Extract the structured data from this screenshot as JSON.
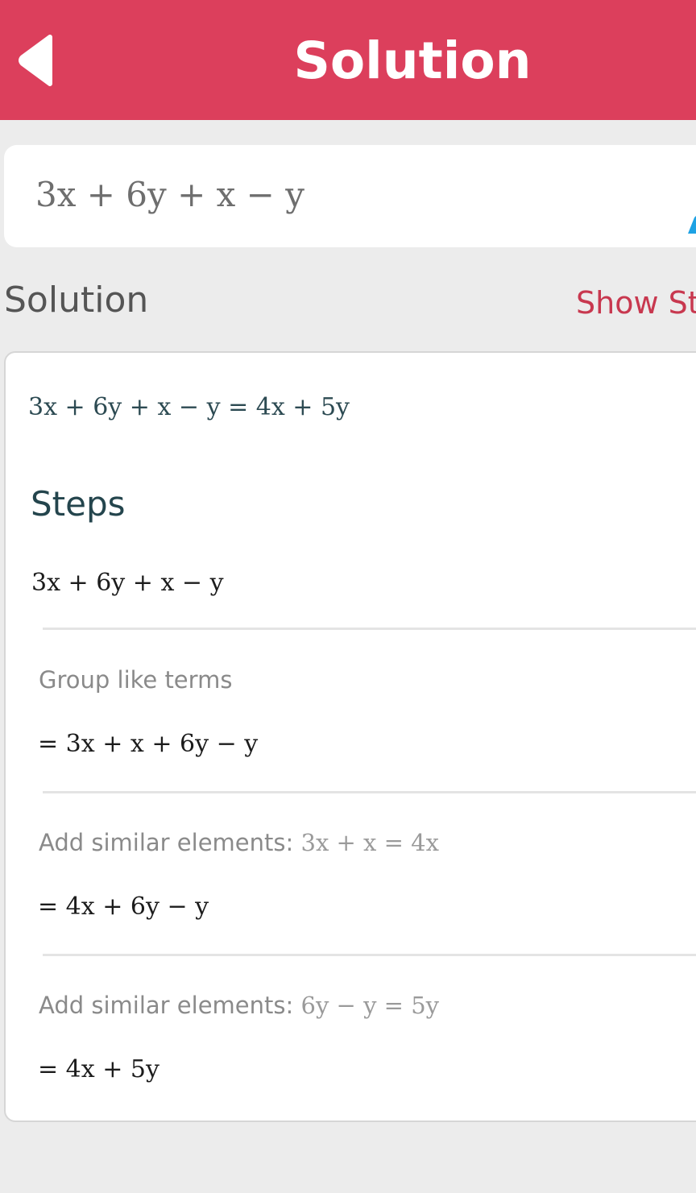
{
  "header": {
    "title": "Solution",
    "back_icon": "chevron-left-icon",
    "background_color": "#dc3f5c"
  },
  "input": {
    "expression": "3x + 6y + x − y",
    "edit_icon": "pencil-icon"
  },
  "solution_section": {
    "label": "Solution",
    "show_steps_label": "Show St",
    "accent_color": "#c8384f"
  },
  "solution_card": {
    "result": "3x + 6y + x − y = 4x + 5y",
    "steps_heading": "Steps",
    "start_expression": "3x + 6y + x − y",
    "steps": [
      {
        "description": "Group like terms",
        "description_math": "",
        "result": "= 3x + x + 6y − y"
      },
      {
        "description": "Add similar elements: ",
        "description_math": "3x + x = 4x",
        "result": "= 4x + 6y − y"
      },
      {
        "description": "Add similar elements: ",
        "description_math": "6y − y = 5y",
        "result": "= 4x + 5y"
      }
    ]
  }
}
